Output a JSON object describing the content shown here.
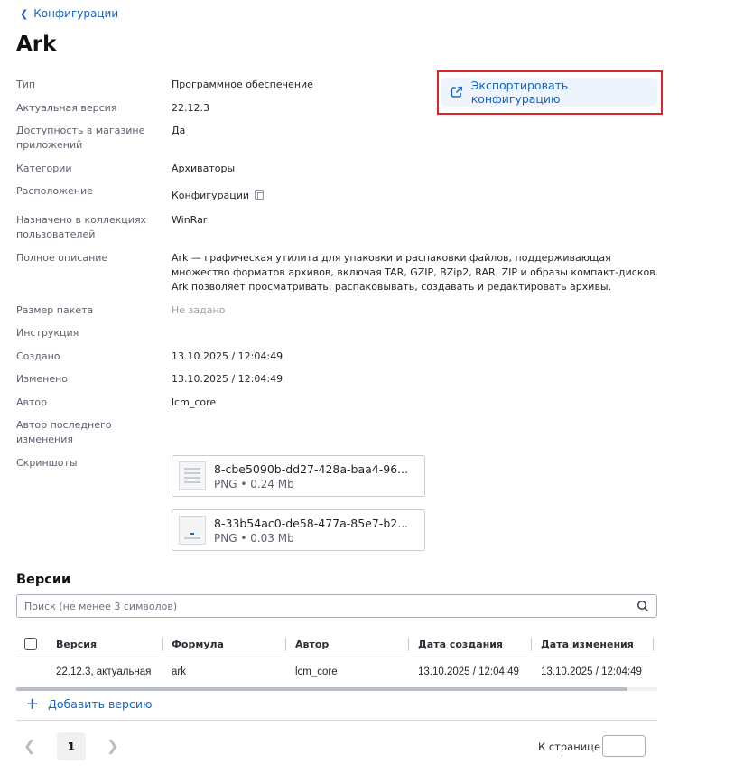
{
  "breadcrumb": {
    "back_label": "Конфигурации"
  },
  "page": {
    "title": "Ark"
  },
  "export_button": {
    "label": "Экспортировать конфигурацию",
    "icon": "external-link-icon"
  },
  "properties": {
    "type": {
      "label": "Тип",
      "value": "Программное обеспечение"
    },
    "version": {
      "label": "Актуальная версия",
      "value": "22.12.3"
    },
    "store": {
      "label": "Доступность в магазине приложений",
      "value": "Да"
    },
    "categories": {
      "label": "Категории",
      "value": "Архиваторы"
    },
    "location": {
      "label": "Расположение",
      "value": "Конфигурации"
    },
    "collections": {
      "label": "Назначено в коллекциях пользователей",
      "value": "WinRar"
    },
    "description": {
      "label": "Полное описание",
      "value": "Ark — графическая утилита для упаковки и распаковки файлов, поддерживающая множество форматов архивов, включая TAR, GZIP, BZip2, RAR, ZIP и образы компакт-дисков. Ark позволяет просматривать, распаковывать, создавать и редактировать архивы."
    },
    "package_size": {
      "label": "Размер пакета",
      "value": "Не задано"
    },
    "instruction": {
      "label": "Инструкция",
      "value": ""
    },
    "created": {
      "label": "Создано",
      "value": "13.10.2025 / 12:04:49"
    },
    "modified": {
      "label": "Изменено",
      "value": "13.10.2025 / 12:04:49"
    },
    "author": {
      "label": "Автор",
      "value": "lcm_core"
    },
    "last_author": {
      "label": "Автор последнего изменения",
      "value": ""
    },
    "screenshots": {
      "label": "Скриншоты"
    }
  },
  "screenshots": [
    {
      "name": "8-cbe5090b-dd27-428a-baa4-96...",
      "meta": "PNG • 0.24 Mb"
    },
    {
      "name": "8-33b54ac0-de58-477a-85e7-b2...",
      "meta": "PNG • 0.03 Mb"
    }
  ],
  "versions": {
    "title": "Версии",
    "search_placeholder": "Поиск (не менее 3 символов)",
    "columns": [
      "Версия",
      "Формула",
      "Автор",
      "Дата создания",
      "Дата изменения"
    ],
    "rows": [
      [
        "22.12.3, актуальная",
        "ark",
        "lcm_core",
        "13.10.2025 / 12:04:49",
        "13.10.2025 / 12:04:49"
      ]
    ],
    "add_label": "Добавить версию"
  },
  "pagination": {
    "current_page": "1",
    "per_page_label": "К странице"
  },
  "colors": {
    "accent": "#1565c0",
    "highlight_border": "#d6272b"
  }
}
